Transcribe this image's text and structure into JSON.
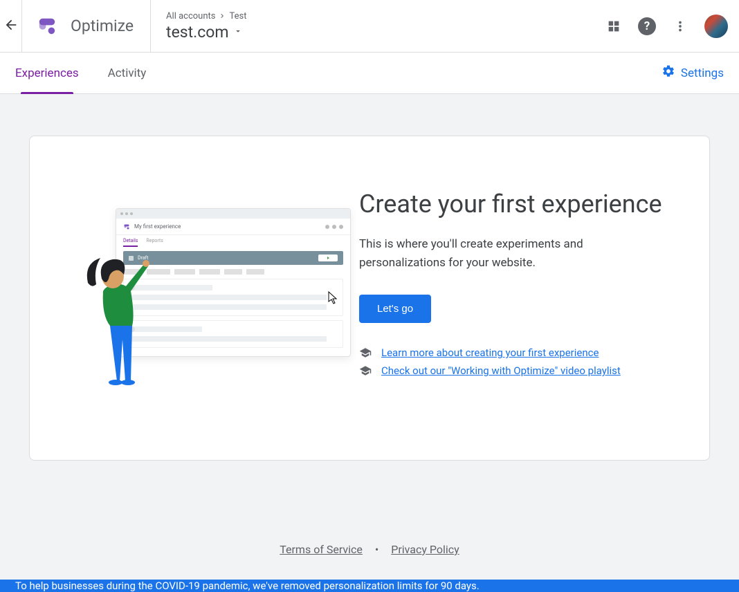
{
  "header": {
    "product_name": "Optimize",
    "breadcrumb_root": "All accounts",
    "breadcrumb_leaf": "Test",
    "site_name": "test.com"
  },
  "tabs": {
    "experiences": "Experiences",
    "activity": "Activity",
    "settings": "Settings"
  },
  "hero": {
    "title": "Create your first experience",
    "description": "This is where you'll create experiments and personalizations for your website.",
    "cta": "Let's go"
  },
  "links": {
    "learn_more": "Learn more about creating your first experience",
    "video_playlist": "Check out our \"Working with Optimize\" video playlist"
  },
  "mock": {
    "title": "My first experience",
    "tab1": "Details",
    "tab2": "Reports",
    "banner": "Draft"
  },
  "footer": {
    "terms": "Terms of Service",
    "privacy": "Privacy Policy"
  },
  "banner": {
    "text": "To help businesses during the COVID-19 pandemic, we've removed personalization limits for 90 days."
  }
}
